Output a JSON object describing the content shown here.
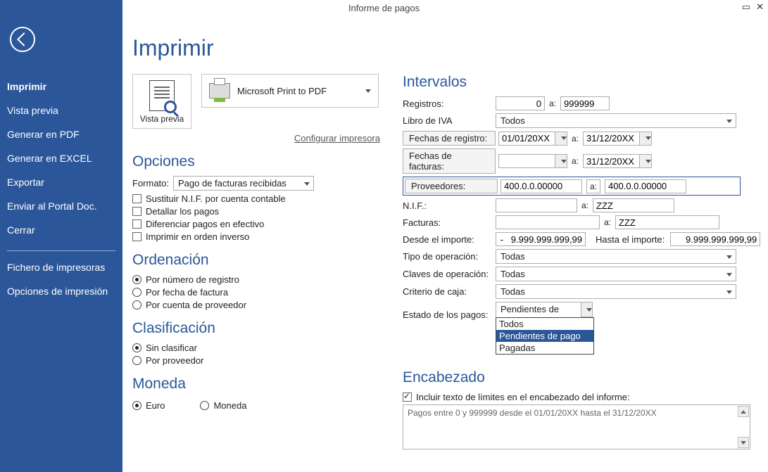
{
  "window": {
    "title": "Informe de pagos"
  },
  "sidebar": {
    "items": [
      "Imprimir",
      "Vista previa",
      "Generar en PDF",
      "Generar en EXCEL",
      "Exportar",
      "Enviar al Portal Doc.",
      "Cerrar"
    ],
    "secondary": [
      "Fichero de impresoras",
      "Opciones de impresión"
    ]
  },
  "page": {
    "title": "Imprimir",
    "preview_label": "Vista previa",
    "printer": "Microsoft Print to PDF",
    "config_link": "Configurar impresora"
  },
  "opciones": {
    "heading": "Opciones",
    "formato_label": "Formato:",
    "formato_value": "Pago de facturas recibidas",
    "cb1": "Sustituir N.I.F. por cuenta contable",
    "cb2": "Detallar los pagos",
    "cb3": "Diferenciar pagos en efectivo",
    "cb4": "Imprimir en orden inverso"
  },
  "orden": {
    "heading": "Ordenación",
    "r1": "Por número de registro",
    "r2": "Por fecha de factura",
    "r3": "Por cuenta de proveedor"
  },
  "clasif": {
    "heading": "Clasificación",
    "r1": "Sin clasificar",
    "r2": "Por proveedor"
  },
  "moneda": {
    "heading": "Moneda",
    "r1": "Euro",
    "r2": "Moneda"
  },
  "intervalos": {
    "heading": "Intervalos",
    "a": "a:",
    "registros_label": "Registros:",
    "registros_from": "0",
    "registros_to": "999999",
    "libro_label": "Libro de IVA",
    "libro_value": "Todos",
    "fechas_reg_btn": "Fechas de registro:",
    "fechas_reg_from": "01/01/20XX",
    "fechas_reg_to": "31/12/20XX",
    "fechas_fac_btn": "Fechas de facturas:",
    "fechas_fac_from": "",
    "fechas_fac_to": "31/12/20XX",
    "prov_btn": "Proveedores:",
    "prov_from": "400.0.0.00000",
    "prov_to": "400.0.0.00000",
    "nif_label": "N.I.F.:",
    "nif_from": "",
    "nif_to": "ZZZ",
    "facturas_label": "Facturas:",
    "facturas_from": "",
    "facturas_to": "ZZZ",
    "desde_imp_label": "Desde el importe:",
    "desde_imp": "-   9.999.999.999,99",
    "hasta_imp_label": "Hasta el importe:",
    "hasta_imp": "9.999.999.999,99",
    "tipo_label": "Tipo de operación:",
    "tipo_value": "Todas",
    "claves_label": "Claves de operación:",
    "claves_value": "Todas",
    "crit_label": "Criterio de caja:",
    "crit_value": "Todas",
    "estado_label": "Estado de los pagos:",
    "estado_value": "Pendientes de pago",
    "estado_options": [
      "Todos",
      "Pendientes de pago",
      "Pagadas"
    ]
  },
  "encabezado": {
    "heading": "Encabezado",
    "cb": "Incluir texto de límites en el encabezado del informe:",
    "text": "Pagos entre 0 y 999999 desde el 01/01/20XX hasta el 31/12/20XX"
  }
}
